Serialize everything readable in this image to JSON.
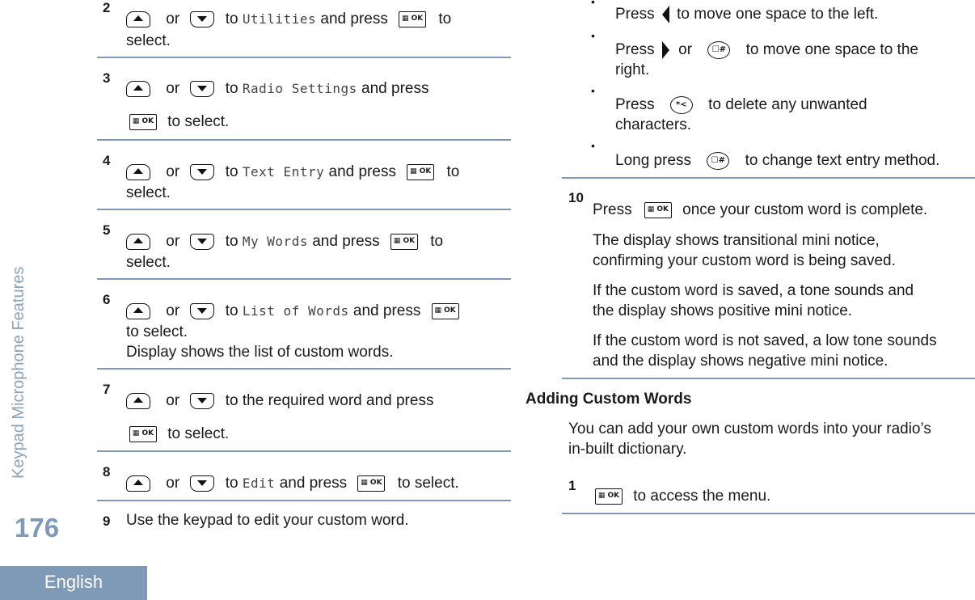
{
  "sidebar": {
    "section_title": "Keypad Microphone Features",
    "page_number": "176",
    "language": "English"
  },
  "common": {
    "or": "or",
    "to": "to",
    "and_press": "and press",
    "to_select": "to select.",
    "select": "select.",
    "press": "Press",
    "long_press": "Long press",
    "ok_key": "▦ OK"
  },
  "left_steps": [
    {
      "number": "2",
      "target": "Utilities"
    },
    {
      "number": "3",
      "target": "Radio Settings"
    },
    {
      "number": "4",
      "target": "Text Entry"
    },
    {
      "number": "5",
      "target": "My Words"
    },
    {
      "number": "6",
      "target": "List of Words",
      "note": "Display shows the list of custom words."
    },
    {
      "number": "7",
      "target_text": "to the required word and press"
    },
    {
      "number": "8",
      "target": "Edit"
    },
    {
      "number": "9",
      "text": "Use the keypad to edit your custom word."
    }
  ],
  "bullets": [
    {
      "prefix": "Press",
      "text": "to move one space to the left.",
      "key": "left-arrow"
    },
    {
      "prefix": "Press",
      "mid": "or",
      "text": "to move one space to the",
      "text2": "right.",
      "key": "right-arrow",
      "key2": "pound-key"
    },
    {
      "prefix": "Press",
      "text": "to delete any unwanted",
      "text2": "characters.",
      "key": "star-key"
    },
    {
      "prefix": "Long press",
      "text": "to change text entry method.",
      "key": "pound-key"
    }
  ],
  "step10": {
    "number": "10",
    "line1": "once your custom word is complete.",
    "para1": [
      "The display shows transitional mini notice,",
      "confirming your custom word is being saved."
    ],
    "para2": [
      "If the custom word is saved, a tone sounds and",
      "the display shows positive mini notice."
    ],
    "para3": [
      "If the custom word is not saved, a low tone sounds",
      "and the display shows negative mini notice."
    ]
  },
  "adding_section": {
    "heading": "Adding Custom Words",
    "intro": [
      "You can add your own custom words into your radio’s",
      "in-built dictionary."
    ],
    "step1": {
      "number": "1",
      "text": "to access the menu."
    }
  },
  "key_glyphs": {
    "pound": "☐#",
    "star": "*<"
  },
  "colors": {
    "accent": "#7f9ab6"
  }
}
